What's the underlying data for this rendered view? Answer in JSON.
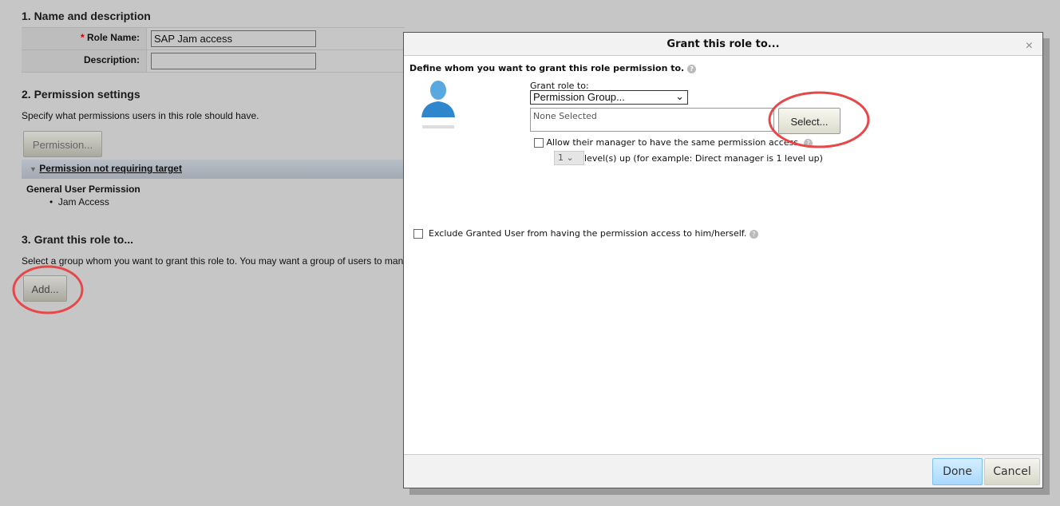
{
  "sections": {
    "s1_title": "1. Name and description",
    "role_name_label": "Role Name:",
    "required_mark": "*",
    "role_name_value": "SAP Jam access",
    "description_label": "Description:",
    "description_value": "",
    "s2_title": "2. Permission settings",
    "s2_desc": "Specify what permissions users in this role should have.",
    "permission_button": "Permission...",
    "perm_group_header": "Permission not requiring target",
    "perm_category": "General User Permission",
    "perm_items": [
      "Jam Access"
    ],
    "s3_title": "3. Grant this role to...",
    "s3_desc": "Select a group whom you want to grant this role to. You may want a group of users to man",
    "add_button": "Add..."
  },
  "dialog": {
    "title": "Grant this role to...",
    "close": "×",
    "intro": "Define whom you want to grant this role permission to.",
    "grant_role_to_label": "Grant role to:",
    "grant_role_to_value": "Permission Group...",
    "selected_value": "None Selected",
    "select_button": "Select...",
    "allow_manager_label": "Allow their manager to have the same permission access.",
    "levels_value": "1",
    "levels_label": "level(s) up (for example: Direct manager is 1 level up)",
    "exclude_label": "Exclude Granted User from having the permission access to him/herself.",
    "done_button": "Done",
    "cancel_button": "Cancel"
  },
  "colors": {
    "annotation": "#e8474a",
    "done_button": "#bfe3ff"
  }
}
